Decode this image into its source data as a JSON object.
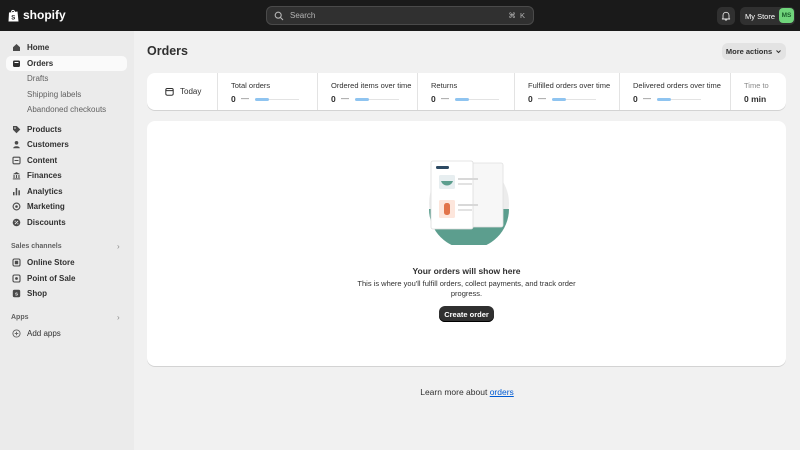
{
  "topbar": {
    "brand": "shopify",
    "search_placeholder": "Search",
    "search_shortcut": "⌘ K",
    "store_name": "My Store",
    "avatar_initials": "MS"
  },
  "sidebar": {
    "items": [
      {
        "label": "Home",
        "icon": "home-icon"
      },
      {
        "label": "Orders",
        "icon": "orders-icon",
        "active": true
      },
      {
        "label": "Products",
        "icon": "tag-icon"
      },
      {
        "label": "Customers",
        "icon": "person-icon"
      },
      {
        "label": "Content",
        "icon": "content-icon"
      },
      {
        "label": "Finances",
        "icon": "bank-icon"
      },
      {
        "label": "Analytics",
        "icon": "chart-bar-icon"
      },
      {
        "label": "Marketing",
        "icon": "target-icon"
      },
      {
        "label": "Discounts",
        "icon": "discount-icon"
      }
    ],
    "order_subitems": [
      "Drafts",
      "Shipping labels",
      "Abandoned checkouts"
    ],
    "sales_channels_label": "Sales channels",
    "sales_channels": [
      {
        "label": "Online Store",
        "icon": "store-icon"
      },
      {
        "label": "Point of Sale",
        "icon": "pos-icon"
      },
      {
        "label": "Shop",
        "icon": "shop-icon"
      }
    ],
    "apps_label": "Apps",
    "add_apps_label": "Add apps"
  },
  "main": {
    "title": "Orders",
    "more_actions": "More actions",
    "date_filter": "Today",
    "metrics": [
      {
        "label": "Total orders",
        "value": "0",
        "trend": "—"
      },
      {
        "label": "Ordered items over time",
        "value": "0",
        "trend": "—"
      },
      {
        "label": "Returns",
        "value": "0",
        "trend": "—"
      },
      {
        "label": "Fulfilled orders over time",
        "value": "0",
        "trend": "—"
      },
      {
        "label": "Delivered orders over time",
        "value": "0",
        "trend": "—"
      },
      {
        "label": "Time to",
        "value": "0 min",
        "trend": ""
      }
    ],
    "empty_state": {
      "title": "Your orders will show here",
      "description": "This is where you'll fulfill orders, collect payments, and track order progress.",
      "button": "Create order"
    },
    "learn_more_prefix": "Learn more about ",
    "learn_more_link": "orders"
  },
  "colors": {
    "topbar": "#1a1a1a",
    "sidebar": "#ebebeb",
    "page": "#f1f1f1",
    "avatar": "#6fd47b",
    "link": "#005bd3",
    "illustration_teal": "#5c9e8e"
  }
}
